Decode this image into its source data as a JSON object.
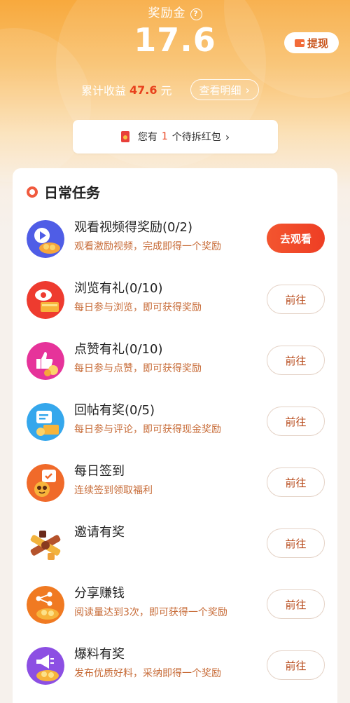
{
  "header": {
    "title": "奖励金",
    "help_glyph": "?",
    "amount": "17.6",
    "withdraw_label": "提现",
    "cumulative_label": "累计收益",
    "cumulative_value": "47.6",
    "cumulative_unit": "元",
    "detail_label": "查看明细",
    "chevron": "›"
  },
  "red_packet": {
    "prefix": "您有",
    "count": "1",
    "suffix": "个待拆红包",
    "chevron": "›"
  },
  "tasks_section": {
    "title": "日常任务",
    "tasks": [
      {
        "name": "观看视频得奖励(0/2)",
        "desc": "观看激励视频，完成即得一个奖励",
        "button": "去观看",
        "icon": "video-play-icon"
      },
      {
        "name": "浏览有礼(0/10)",
        "desc": "每日参与浏览，即可获得奖励",
        "button": "前往",
        "icon": "browse-eye-icon"
      },
      {
        "name": "点赞有礼(0/10)",
        "desc": "每日参与点赞，即可获得奖励",
        "button": "前往",
        "icon": "thumbs-up-icon"
      },
      {
        "name": "回帖有奖(0/5)",
        "desc": "每日参与评论，即可获得现金奖励",
        "button": "前往",
        "icon": "comment-icon"
      },
      {
        "name": "每日签到",
        "desc": "连续签到领取福利",
        "button": "前往",
        "icon": "calendar-checkin-icon"
      },
      {
        "name": "邀请有奖",
        "desc": "",
        "button": "前往",
        "icon": "invite-handshake-icon"
      },
      {
        "name": "分享赚钱",
        "desc": "阅读量达到3次，即可获得一个奖励",
        "button": "前往",
        "icon": "share-icon"
      },
      {
        "name": "爆料有奖",
        "desc": "发布优质好料，采纳即得一个奖励",
        "button": "前往",
        "icon": "megaphone-icon"
      }
    ]
  },
  "colors": {
    "accent": "#f05a3e",
    "primary_button": "#ee3e24",
    "desc_text": "#c76b37",
    "hero_top": "#f8a93d"
  }
}
